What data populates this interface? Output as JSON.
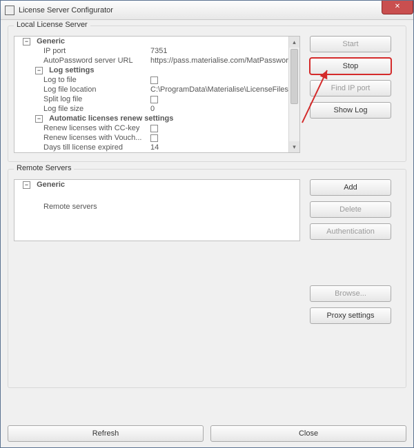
{
  "window": {
    "title": "License Server Configurator"
  },
  "groups": {
    "local": "Local License Server",
    "remote": "Remote Servers"
  },
  "local_tree": {
    "generic": "Generic",
    "ip_port": {
      "label": "IP port",
      "value": "7351"
    },
    "auto_url": {
      "label": "AutoPassword server URL",
      "value": "https://pass.materialise.com/MatPasswordsWS/M"
    },
    "log_settings": "Log settings",
    "log_to_file": {
      "label": "Log to file"
    },
    "log_file_location": {
      "label": "Log file location",
      "value": "C:\\ProgramData\\Materialise\\LicenseFiles"
    },
    "split_log": {
      "label": "Split log file"
    },
    "log_file_size": {
      "label": "Log file size",
      "value": "0"
    },
    "auto_renew": "Automatic licenses renew settings",
    "renew_cc": {
      "label": "Renew licenses with CC-key"
    },
    "renew_vouch": {
      "label": "Renew licenses with Vouch..."
    },
    "days_till": {
      "label": "Days till license expired",
      "value": "14"
    }
  },
  "remote_tree": {
    "generic": "Generic",
    "remote_servers": {
      "label": "Remote servers",
      "value": ""
    }
  },
  "side_buttons": {
    "start": "Start",
    "stop": "Stop",
    "find_ip": "Find IP port",
    "show_log": "Show Log",
    "add": "Add",
    "delete": "Delete",
    "auth": "Authentication",
    "browse": "Browse...",
    "proxy": "Proxy settings"
  },
  "footer": {
    "refresh": "Refresh",
    "close": "Close"
  },
  "icons": {
    "close": "✕",
    "minus": "−",
    "up": "▴",
    "down": "▾"
  }
}
